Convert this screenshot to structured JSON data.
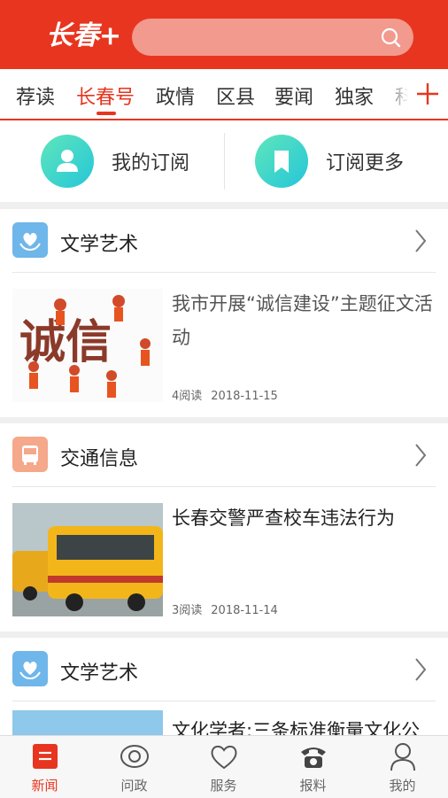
{
  "header": {
    "logo_text": "长春+",
    "search_icon": "search-icon",
    "brand_color": "#e8351f"
  },
  "tabs": {
    "items": [
      "荐读",
      "长春号",
      "政情",
      "区县",
      "要闻",
      "独家",
      "科"
    ],
    "active_index": 1,
    "add_icon": "plus-icon"
  },
  "subscription": {
    "my_subscriptions": "我的订阅",
    "more_subscriptions": "订阅更多"
  },
  "sections": [
    {
      "category": "文学艺术",
      "icon": "heart-hands-icon",
      "article": {
        "title": "我市开展“诚信建设”主题征文活动",
        "reads": "4阅读",
        "date": "2018-11-15",
        "thumb_text": "诚信"
      }
    },
    {
      "category": "交通信息",
      "icon": "bus-icon",
      "article": {
        "title": "长春交警严查校车违法行为",
        "reads": "3阅读",
        "date": "2018-11-14"
      }
    },
    {
      "category": "文学艺术",
      "icon": "heart-hands-icon",
      "article": {
        "title": "文化学者:三条标准衡量文化公"
      }
    }
  ],
  "bottom_nav": {
    "items": [
      {
        "label": "新闻",
        "icon": "news-icon"
      },
      {
        "label": "问政",
        "icon": "eye-icon"
      },
      {
        "label": "服务",
        "icon": "heart-icon"
      },
      {
        "label": "报料",
        "icon": "phone-icon"
      },
      {
        "label": "我的",
        "icon": "user-icon"
      }
    ],
    "active_index": 0
  }
}
